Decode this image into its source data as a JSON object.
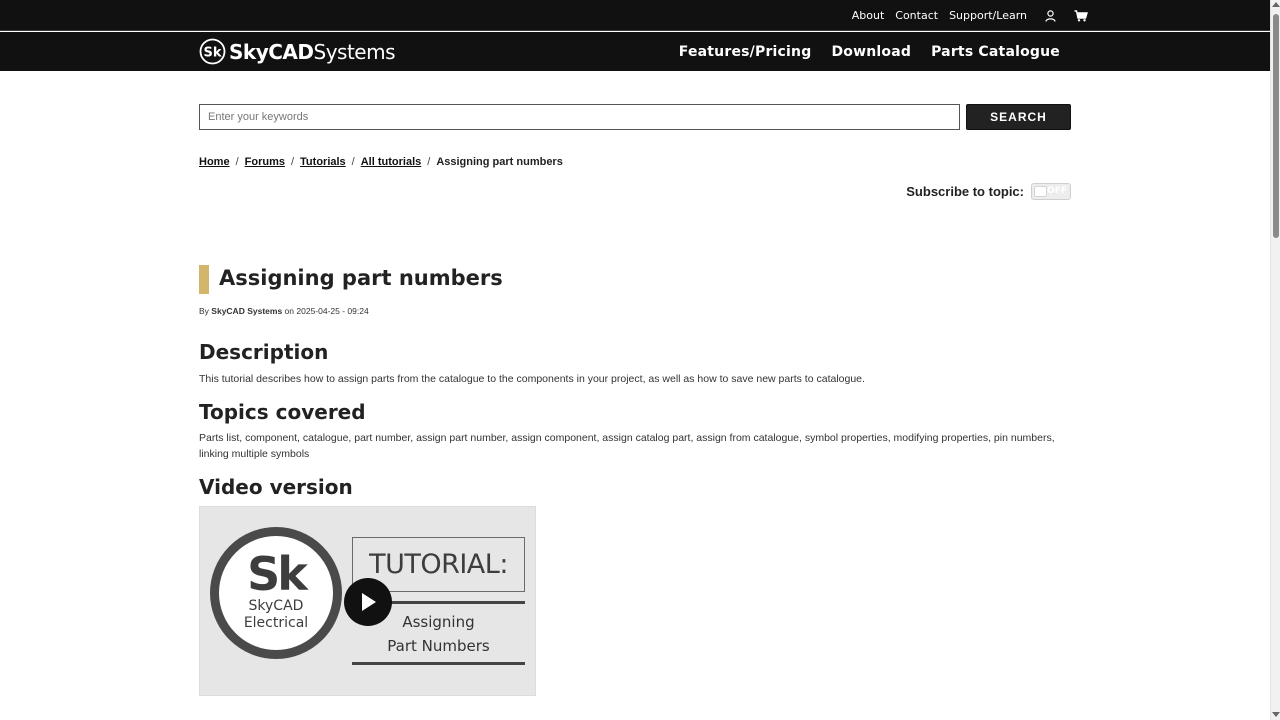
{
  "topbar": {
    "links": [
      "About",
      "Contact",
      "Support/Learn"
    ],
    "icons": [
      "user-icon",
      "cart-icon"
    ]
  },
  "header": {
    "logo_mark": "Sk",
    "logo_bold": "SkyCAD",
    "logo_light": "Systems",
    "nav": [
      "Features/Pricing",
      "Download",
      "Parts Catalogue"
    ]
  },
  "search": {
    "placeholder": "Enter your keywords",
    "button_label": "SEARCH"
  },
  "breadcrumb": {
    "items": [
      "Home",
      "Forums",
      "Tutorials",
      "All tutorials"
    ],
    "separator": "/",
    "current": "Assigning part numbers"
  },
  "subscribe": {
    "label": "Subscribe to topic:",
    "state": "OFF"
  },
  "article": {
    "title": "Assigning part numbers",
    "accent_color": "#d2b66b",
    "byline_prefix": "By",
    "author": "SkyCAD Systems",
    "byline_on": "on",
    "date": "2025-04-25 - 09:24",
    "description_heading": "Description",
    "description": "This tutorial describes how to assign parts from the catalogue to the components in your project, as well as how to save new parts to catalogue.",
    "topics_heading": "Topics covered",
    "topics": "Parts list, component, catalogue, part number, assign part number, assign component, assign catalog part, assign from catalogue, symbol properties, modifying properties, pin numbers, linking multiple symbols",
    "video_heading": "Video version"
  },
  "video": {
    "mark": "Sk",
    "sub1": "SkyCAD",
    "sub2": "Electrical",
    "banner": "TUTORIAL:",
    "caption1": "Assigning",
    "caption2": "Part Numbers",
    "play_icon": "play-icon"
  },
  "colors": {
    "header_bg": "#111111",
    "accent": "#d2b66b",
    "button_bg": "#222222"
  }
}
